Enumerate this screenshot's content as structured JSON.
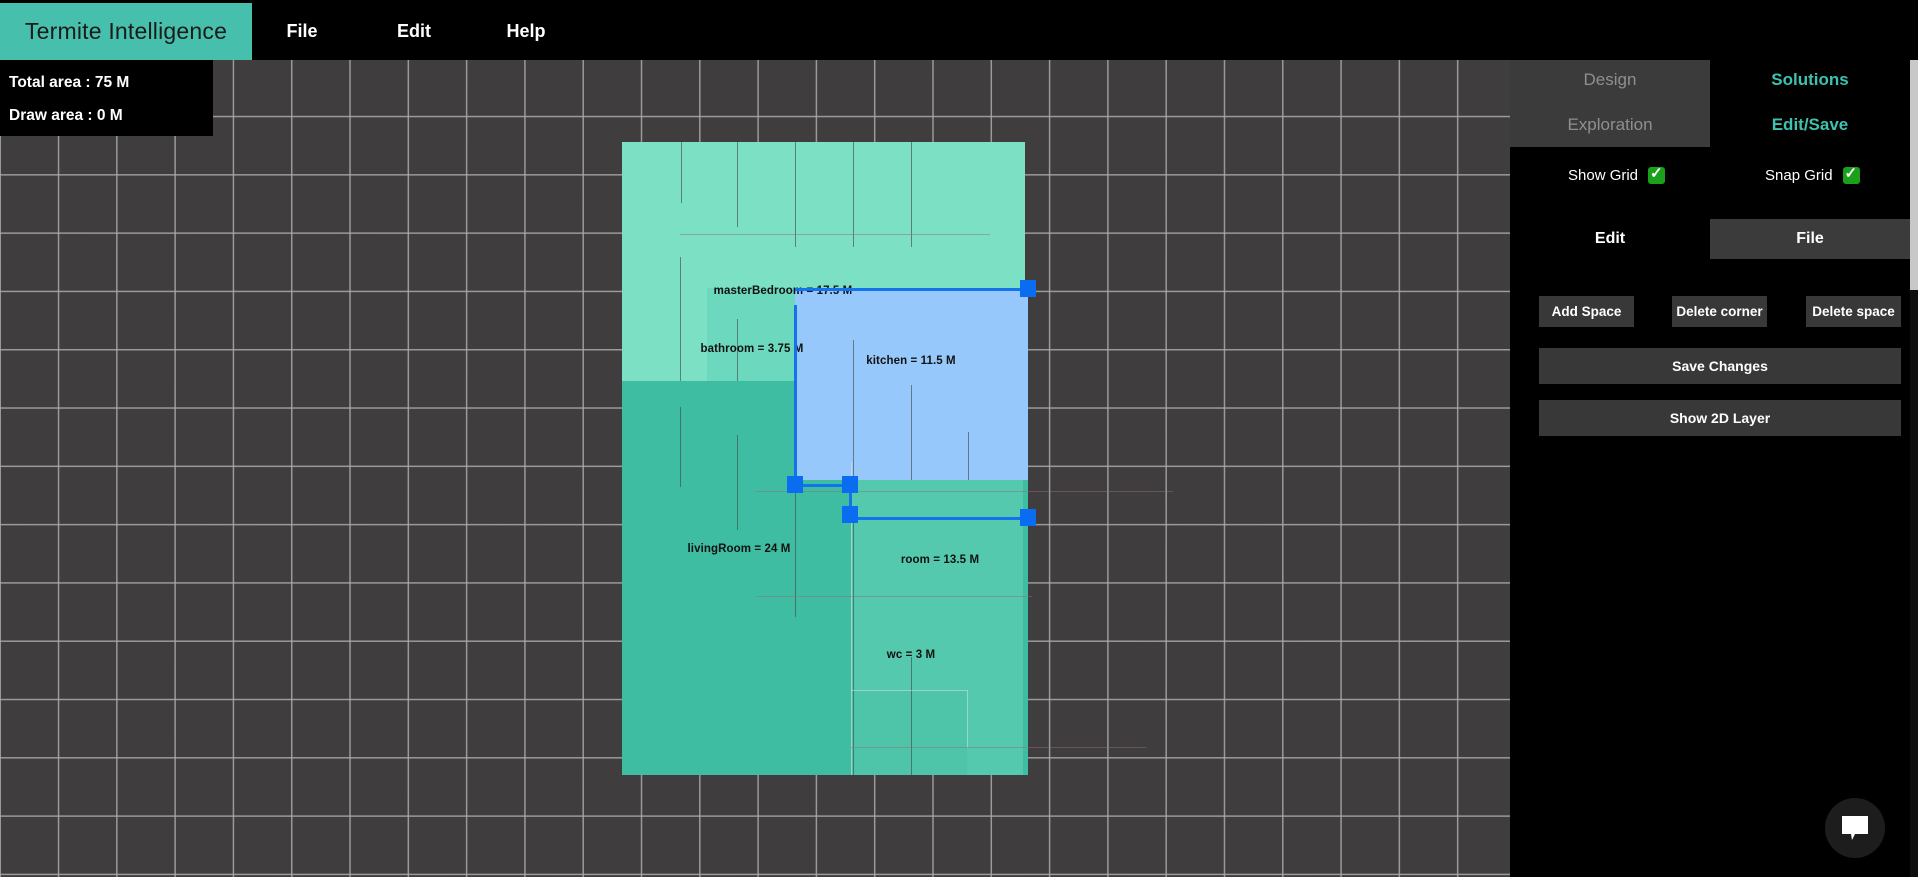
{
  "app": {
    "brand": "Termite Intelligence",
    "accent_teal": "#46c0ac",
    "accent_green": "#3ec2ae",
    "selection_blue": "#0a6cf1"
  },
  "menubar": {
    "items": [
      {
        "label": "File"
      },
      {
        "label": "Edit"
      },
      {
        "label": "Help"
      }
    ]
  },
  "info": {
    "total_area": "Total area : 75 M",
    "draw_area": "Draw area : 0 M"
  },
  "sidebar": {
    "mode_tabs": [
      {
        "label": "Design",
        "state": "disabled"
      },
      {
        "label": "Solutions",
        "state": "active"
      },
      {
        "label": "Exploration",
        "state": "disabled"
      },
      {
        "label": "Edit/Save",
        "state": "active"
      }
    ],
    "toggles": [
      {
        "label": "Show Grid",
        "checked": true
      },
      {
        "label": "Snap Grid",
        "checked": true
      }
    ],
    "sub_tabs": [
      {
        "label": "Edit",
        "active": true
      },
      {
        "label": "File",
        "active": false
      }
    ],
    "buttons": [
      {
        "label": "Add Space"
      },
      {
        "label": "Delete corner"
      },
      {
        "label": "Delete space"
      },
      {
        "label": "Save Changes"
      },
      {
        "label": "Show 2D Layer"
      }
    ]
  },
  "canvas": {
    "grid_visible": true,
    "grid_spacing_px": 58.3,
    "background": "#3f3d3e",
    "rooms": [
      {
        "name": "masterBedroom",
        "label": "masterBedroom = 17.5 M",
        "area": 17.5,
        "unit": "M",
        "color": "#7ce0c5"
      },
      {
        "name": "bathroom",
        "label": "bathroom = 3.75 M",
        "area": 3.75,
        "unit": "M",
        "color": "#6cd8bd"
      },
      {
        "name": "kitchen",
        "label": "kitchen = 11.5 M",
        "area": 11.5,
        "unit": "M",
        "color": "#96c8fb",
        "selected": true
      },
      {
        "name": "livingRoom",
        "label": "livingRoom = 24 M",
        "area": 24,
        "unit": "M",
        "color": "#3fbda2"
      },
      {
        "name": "room",
        "label": "room = 13.5 M",
        "area": 13.5,
        "unit": "M",
        "color": "#55c9ad"
      },
      {
        "name": "wc",
        "label": "wc = 3 M",
        "area": 3,
        "unit": "M",
        "color": "#4ec4a8"
      }
    ]
  },
  "chat": {
    "icon": "chat-bubble-icon"
  }
}
